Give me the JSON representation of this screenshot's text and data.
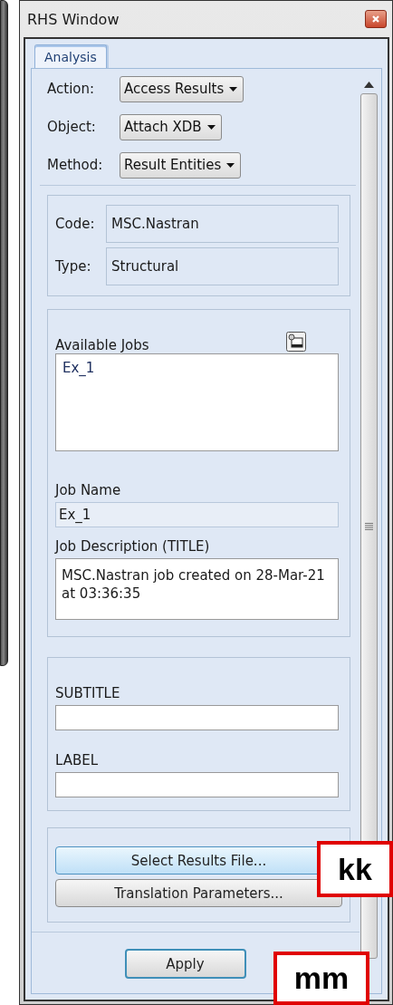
{
  "window": {
    "title": "RHS Window"
  },
  "tabs": [
    {
      "label": "Analysis",
      "selected": true
    }
  ],
  "selectors": [
    {
      "label": "Action:",
      "value": "Access Results"
    },
    {
      "label": "Object:",
      "value": "Attach XDB"
    },
    {
      "label": "Method:",
      "value": "Result Entities"
    }
  ],
  "info": [
    {
      "label": "Code:",
      "value": "MSC.Nastran"
    },
    {
      "label": "Type:",
      "value": "Structural"
    }
  ],
  "available_jobs": {
    "label": "Available Jobs",
    "items": [
      {
        "label": "Ex_1",
        "selected": false
      }
    ]
  },
  "job_name": {
    "label": "Job Name",
    "value": "Ex_1"
  },
  "job_description": {
    "label": "Job Description (TITLE)",
    "value": "MSC.Nastran job created on 28-Mar-21 at 03:36:35"
  },
  "subtitle": {
    "label": "SUBTITLE"
  },
  "label_field": {
    "label": "LABEL"
  },
  "buttons": [
    {
      "label": "Select Results File...",
      "highlighted": true
    },
    {
      "label": "Translation Parameters...",
      "highlighted": false
    }
  ],
  "apply_button": {
    "label": "Apply"
  },
  "annotations": [
    {
      "text": "kk"
    },
    {
      "text": "mm"
    }
  ]
}
